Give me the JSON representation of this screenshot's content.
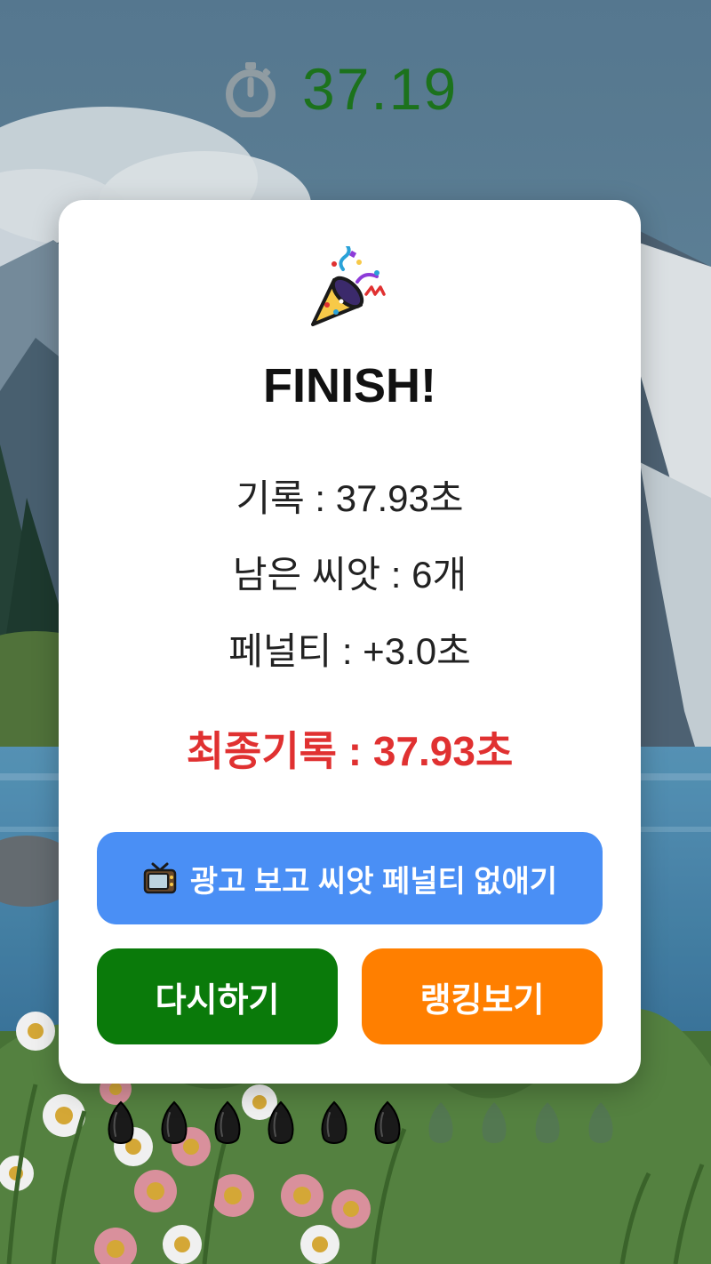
{
  "hud": {
    "timer_icon": "stopwatch-icon",
    "timer_value": "37.19"
  },
  "result": {
    "icon": "party-popper-icon",
    "title": "FINISH!",
    "record": "기록 : 37.93초",
    "remaining_seeds": "남은 씨앗 : 6개",
    "penalty": "페널티 : +3.0초",
    "final_record": "최종기록 : 37.93초"
  },
  "buttons": {
    "ad_icon": "tv-icon",
    "ad_label": "광고 보고 씨앗 페널티 없애기",
    "retry_label": "다시하기",
    "ranking_label": "랭킹보기"
  },
  "seeds": {
    "total": 10,
    "remaining": 6
  },
  "colors": {
    "timer": "#1e7a1e",
    "final_record": "#e03131",
    "ad_button": "#4a8ff5",
    "retry_button": "#0a7a0a",
    "ranking_button": "#ff7f00"
  }
}
